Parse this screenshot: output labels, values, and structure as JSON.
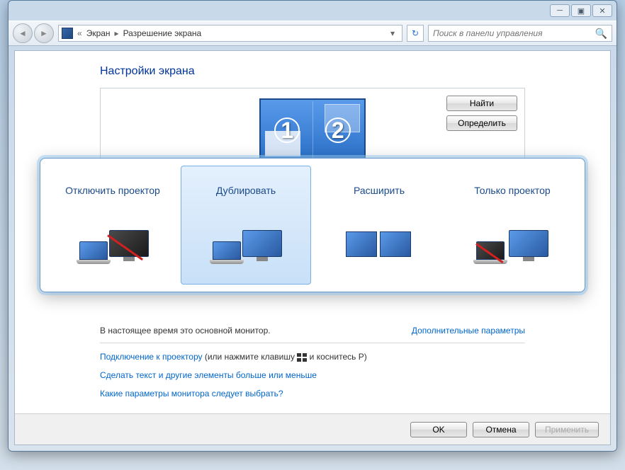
{
  "titlebar": {
    "minimize": "─",
    "maximize": "▣",
    "close": "✕"
  },
  "breadcrumb": {
    "sep_back": "«",
    "root": "Экран",
    "arrow": "▸",
    "current": "Разрешение экрана",
    "dropdown": "▾"
  },
  "search": {
    "placeholder": "Поиск в панели управления"
  },
  "page": {
    "title": "Настройки экрана",
    "monitor1": "1",
    "monitor2": "2",
    "detect_btn": "Найти",
    "identify_btn": "Определить",
    "primary_text": "В настоящее время это основной монитор.",
    "advanced_link": "Дополнительные параметры"
  },
  "links": {
    "projector_link": "Подключение к проектору",
    "projector_hint_a": " (или нажмите клавишу ",
    "projector_hint_b": " и коснитесь P)",
    "text_size": "Сделать текст и другие элементы больше или меньше",
    "which_settings": "Какие параметры монитора следует выбрать?"
  },
  "buttons": {
    "ok": "OK",
    "cancel": "Отмена",
    "apply": "Применить"
  },
  "projector": {
    "opt1": "Отключить проектор",
    "opt2": "Дублировать",
    "opt3": "Расширить",
    "opt4": "Только проектор"
  }
}
